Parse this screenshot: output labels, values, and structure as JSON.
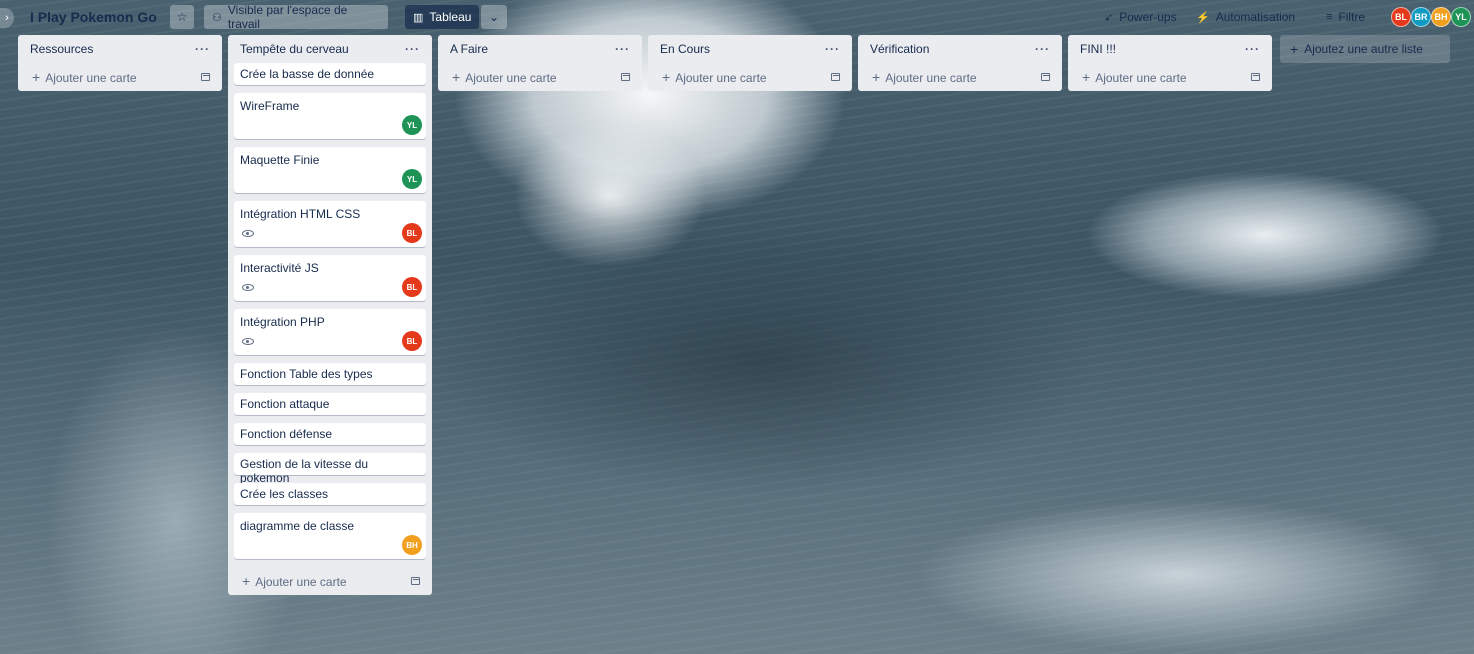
{
  "board": {
    "title": "I Play Pokemon Go",
    "visibility_label": "Visible par l'espace de travail",
    "view_label": "Tableau",
    "powerups_label": "Power-ups",
    "automation_label": "Automatisation",
    "filter_label": "Filtre"
  },
  "members": [
    {
      "initials": "BL",
      "color": "#e5391b"
    },
    {
      "initials": "BR",
      "color": "#0f9ac2"
    },
    {
      "initials": "BH",
      "color": "#f0a01e"
    },
    {
      "initials": "YL",
      "color": "#1d9456"
    }
  ],
  "lists": [
    {
      "title": "Ressources",
      "add_card_label": "Ajouter une carte",
      "cards": []
    },
    {
      "title": "Tempête du cerveau",
      "add_card_label": "Ajouter une carte",
      "cards": [
        {
          "title": "Crée la basse de donnée"
        },
        {
          "title": "WireFrame",
          "member": "YL"
        },
        {
          "title": "Maquette Finie",
          "member": "YL"
        },
        {
          "title": "Intégration HTML CSS",
          "member": "BL",
          "watched": true
        },
        {
          "title": "Interactivité JS",
          "member": "BL",
          "watched": true
        },
        {
          "title": "Intégration PHP",
          "member": "BL",
          "watched": true
        },
        {
          "title": "Fonction Table des types"
        },
        {
          "title": "Fonction attaque"
        },
        {
          "title": "Fonction défense"
        },
        {
          "title": "Gestion de la vitesse du pokemon"
        },
        {
          "title": "Crée les classes"
        },
        {
          "title": "diagramme de classe",
          "member": "BH"
        }
      ]
    },
    {
      "title": "A Faire",
      "add_card_label": "Ajouter une carte",
      "cards": []
    },
    {
      "title": "En Cours",
      "add_card_label": "Ajouter une carte",
      "cards": []
    },
    {
      "title": "Vérification",
      "add_card_label": "Ajouter une carte",
      "cards": []
    },
    {
      "title": "FINI !!!",
      "add_card_label": "Ajouter une carte",
      "cards": []
    }
  ],
  "add_list_label": "Ajoutez une autre liste",
  "icons": {
    "star": "star-icon",
    "visibility": "people-icon",
    "view": "board-icon",
    "powerups": "rocket-icon",
    "automation": "lightning-icon",
    "filter": "filter-icon",
    "watch": "eye-icon",
    "template": "card-template-icon"
  }
}
